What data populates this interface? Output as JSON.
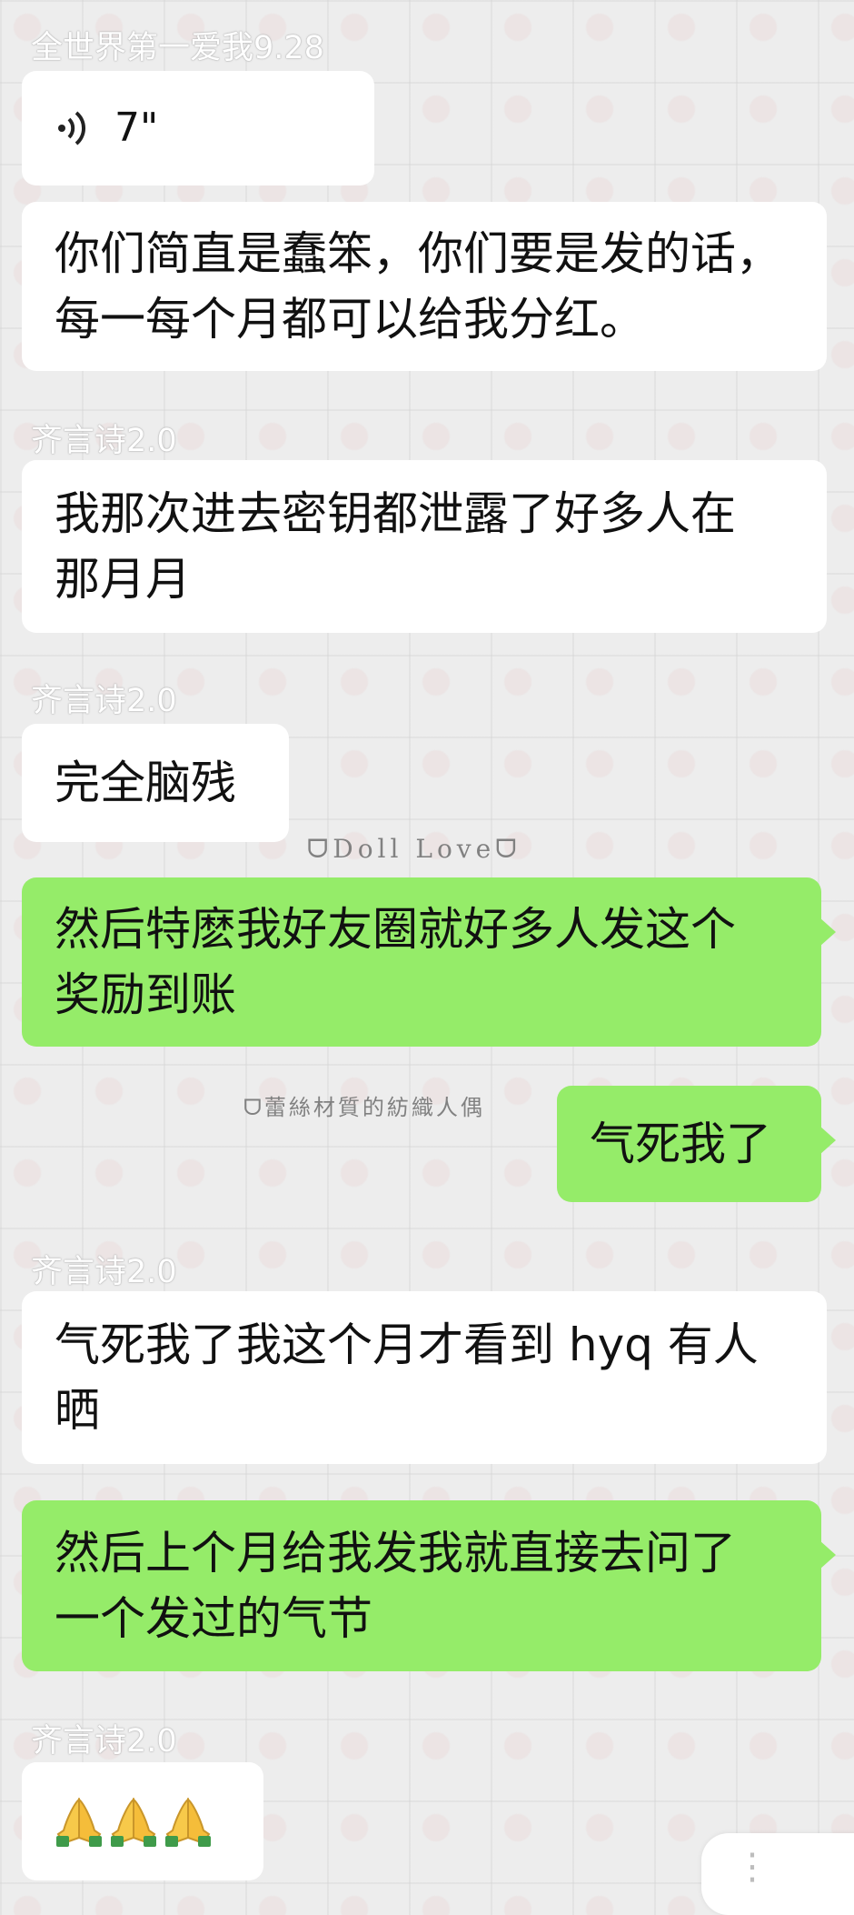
{
  "messages": [
    {
      "sender": "全世界第一爱我9.28",
      "type": "voice",
      "duration": "7\""
    },
    {
      "type": "text",
      "direction": "in",
      "lines": [
        "你们简直是蠢笨，你们要是发的话，",
        "每一每个月都可以给我分红。"
      ]
    },
    {
      "sender": "齐言诗2.0",
      "type": "text",
      "direction": "in",
      "lines": [
        "我那次进去密钥都泄露了好多人在",
        "那月月"
      ]
    },
    {
      "sender": "齐言诗2.0",
      "type": "text",
      "direction": "in",
      "lines": [
        "完全脑残"
      ]
    },
    {
      "type": "text",
      "direction": "out",
      "lines": [
        "然后特麽我好友圈就好多人发这个",
        "奖励到账"
      ]
    },
    {
      "type": "text",
      "direction": "out",
      "lines": [
        "气死我了"
      ]
    },
    {
      "sender": "齐言诗2.0",
      "type": "text",
      "direction": "in",
      "lines": [
        "气死我了我这个月才看到 hyq 有人",
        "晒"
      ]
    },
    {
      "type": "text",
      "direction": "out",
      "lines": [
        "然后上个月给我发我就直接去问了",
        "一个发过的气节"
      ]
    },
    {
      "sender": "齐言诗2.0",
      "type": "emoji",
      "emoji_count": 3,
      "emoji_name": "folded-hands-icon"
    }
  ],
  "watermarks": [
    "ᗜDoll Loveᗜ",
    "ᗜ蕾絲材質的紡織人偶"
  ],
  "colors": {
    "incoming_bubble": "#ffffff",
    "outgoing_bubble": "#95ec69",
    "background": "#ededed"
  }
}
